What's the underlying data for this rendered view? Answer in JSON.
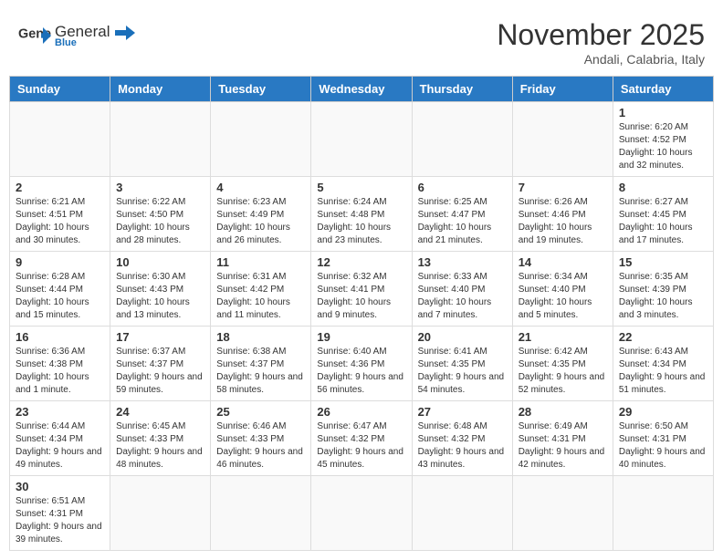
{
  "header": {
    "logo_general": "General",
    "logo_blue": "Blue",
    "month_title": "November 2025",
    "subtitle": "Andali, Calabria, Italy"
  },
  "weekdays": [
    "Sunday",
    "Monday",
    "Tuesday",
    "Wednesday",
    "Thursday",
    "Friday",
    "Saturday"
  ],
  "weeks": [
    [
      {
        "day": "",
        "info": ""
      },
      {
        "day": "",
        "info": ""
      },
      {
        "day": "",
        "info": ""
      },
      {
        "day": "",
        "info": ""
      },
      {
        "day": "",
        "info": ""
      },
      {
        "day": "",
        "info": ""
      },
      {
        "day": "1",
        "info": "Sunrise: 6:20 AM\nSunset: 4:52 PM\nDaylight: 10 hours\nand 32 minutes."
      }
    ],
    [
      {
        "day": "2",
        "info": "Sunrise: 6:21 AM\nSunset: 4:51 PM\nDaylight: 10 hours\nand 30 minutes."
      },
      {
        "day": "3",
        "info": "Sunrise: 6:22 AM\nSunset: 4:50 PM\nDaylight: 10 hours\nand 28 minutes."
      },
      {
        "day": "4",
        "info": "Sunrise: 6:23 AM\nSunset: 4:49 PM\nDaylight: 10 hours\nand 26 minutes."
      },
      {
        "day": "5",
        "info": "Sunrise: 6:24 AM\nSunset: 4:48 PM\nDaylight: 10 hours\nand 23 minutes."
      },
      {
        "day": "6",
        "info": "Sunrise: 6:25 AM\nSunset: 4:47 PM\nDaylight: 10 hours\nand 21 minutes."
      },
      {
        "day": "7",
        "info": "Sunrise: 6:26 AM\nSunset: 4:46 PM\nDaylight: 10 hours\nand 19 minutes."
      },
      {
        "day": "8",
        "info": "Sunrise: 6:27 AM\nSunset: 4:45 PM\nDaylight: 10 hours\nand 17 minutes."
      }
    ],
    [
      {
        "day": "9",
        "info": "Sunrise: 6:28 AM\nSunset: 4:44 PM\nDaylight: 10 hours\nand 15 minutes."
      },
      {
        "day": "10",
        "info": "Sunrise: 6:30 AM\nSunset: 4:43 PM\nDaylight: 10 hours\nand 13 minutes."
      },
      {
        "day": "11",
        "info": "Sunrise: 6:31 AM\nSunset: 4:42 PM\nDaylight: 10 hours\nand 11 minutes."
      },
      {
        "day": "12",
        "info": "Sunrise: 6:32 AM\nSunset: 4:41 PM\nDaylight: 10 hours\nand 9 minutes."
      },
      {
        "day": "13",
        "info": "Sunrise: 6:33 AM\nSunset: 4:40 PM\nDaylight: 10 hours\nand 7 minutes."
      },
      {
        "day": "14",
        "info": "Sunrise: 6:34 AM\nSunset: 4:40 PM\nDaylight: 10 hours\nand 5 minutes."
      },
      {
        "day": "15",
        "info": "Sunrise: 6:35 AM\nSunset: 4:39 PM\nDaylight: 10 hours\nand 3 minutes."
      }
    ],
    [
      {
        "day": "16",
        "info": "Sunrise: 6:36 AM\nSunset: 4:38 PM\nDaylight: 10 hours\nand 1 minute."
      },
      {
        "day": "17",
        "info": "Sunrise: 6:37 AM\nSunset: 4:37 PM\nDaylight: 9 hours\nand 59 minutes."
      },
      {
        "day": "18",
        "info": "Sunrise: 6:38 AM\nSunset: 4:37 PM\nDaylight: 9 hours\nand 58 minutes."
      },
      {
        "day": "19",
        "info": "Sunrise: 6:40 AM\nSunset: 4:36 PM\nDaylight: 9 hours\nand 56 minutes."
      },
      {
        "day": "20",
        "info": "Sunrise: 6:41 AM\nSunset: 4:35 PM\nDaylight: 9 hours\nand 54 minutes."
      },
      {
        "day": "21",
        "info": "Sunrise: 6:42 AM\nSunset: 4:35 PM\nDaylight: 9 hours\nand 52 minutes."
      },
      {
        "day": "22",
        "info": "Sunrise: 6:43 AM\nSunset: 4:34 PM\nDaylight: 9 hours\nand 51 minutes."
      }
    ],
    [
      {
        "day": "23",
        "info": "Sunrise: 6:44 AM\nSunset: 4:34 PM\nDaylight: 9 hours\nand 49 minutes."
      },
      {
        "day": "24",
        "info": "Sunrise: 6:45 AM\nSunset: 4:33 PM\nDaylight: 9 hours\nand 48 minutes."
      },
      {
        "day": "25",
        "info": "Sunrise: 6:46 AM\nSunset: 4:33 PM\nDaylight: 9 hours\nand 46 minutes."
      },
      {
        "day": "26",
        "info": "Sunrise: 6:47 AM\nSunset: 4:32 PM\nDaylight: 9 hours\nand 45 minutes."
      },
      {
        "day": "27",
        "info": "Sunrise: 6:48 AM\nSunset: 4:32 PM\nDaylight: 9 hours\nand 43 minutes."
      },
      {
        "day": "28",
        "info": "Sunrise: 6:49 AM\nSunset: 4:31 PM\nDaylight: 9 hours\nand 42 minutes."
      },
      {
        "day": "29",
        "info": "Sunrise: 6:50 AM\nSunset: 4:31 PM\nDaylight: 9 hours\nand 40 minutes."
      }
    ],
    [
      {
        "day": "30",
        "info": "Sunrise: 6:51 AM\nSunset: 4:31 PM\nDaylight: 9 hours\nand 39 minutes."
      },
      {
        "day": "",
        "info": ""
      },
      {
        "day": "",
        "info": ""
      },
      {
        "day": "",
        "info": ""
      },
      {
        "day": "",
        "info": ""
      },
      {
        "day": "",
        "info": ""
      },
      {
        "day": "",
        "info": ""
      }
    ]
  ]
}
